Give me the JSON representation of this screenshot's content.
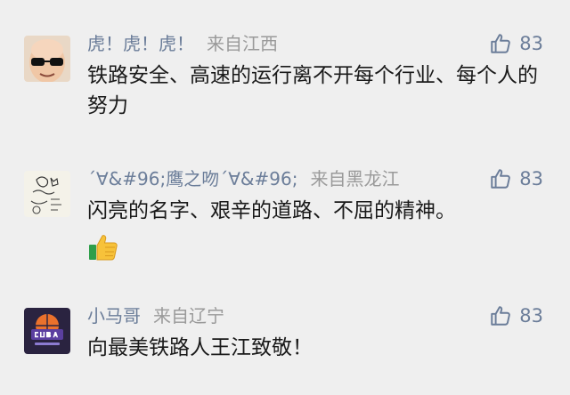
{
  "comments": [
    {
      "username": "虎！虎！虎！",
      "location": "来自江西",
      "likes": "83",
      "text": "铁路安全、高速的运行离不开每个行业、每个人的努力",
      "avatar_icon": "bald-man-glasses-avatar"
    },
    {
      "username": "´∀&#96;鹰之吻´∀&#96;",
      "location": "来自黑龙江",
      "likes": "83",
      "text": "闪亮的名字、艰辛的道路、不屈的精神。",
      "avatar_icon": "hand-drawn-sketch-avatar",
      "emoji": "thumbs-up-emoji"
    },
    {
      "username": "小马哥",
      "location": "来自辽宁",
      "likes": "83",
      "text": "向最美铁路人王江致敬！",
      "avatar_icon": "cuba-basketball-logo-avatar"
    }
  ],
  "colors": {
    "background": "#efefef",
    "username": "#6b7d99",
    "location": "#9a9a9a",
    "text": "#1a1a1a"
  },
  "icons": {
    "like": "thumbs-up-outline-icon"
  }
}
